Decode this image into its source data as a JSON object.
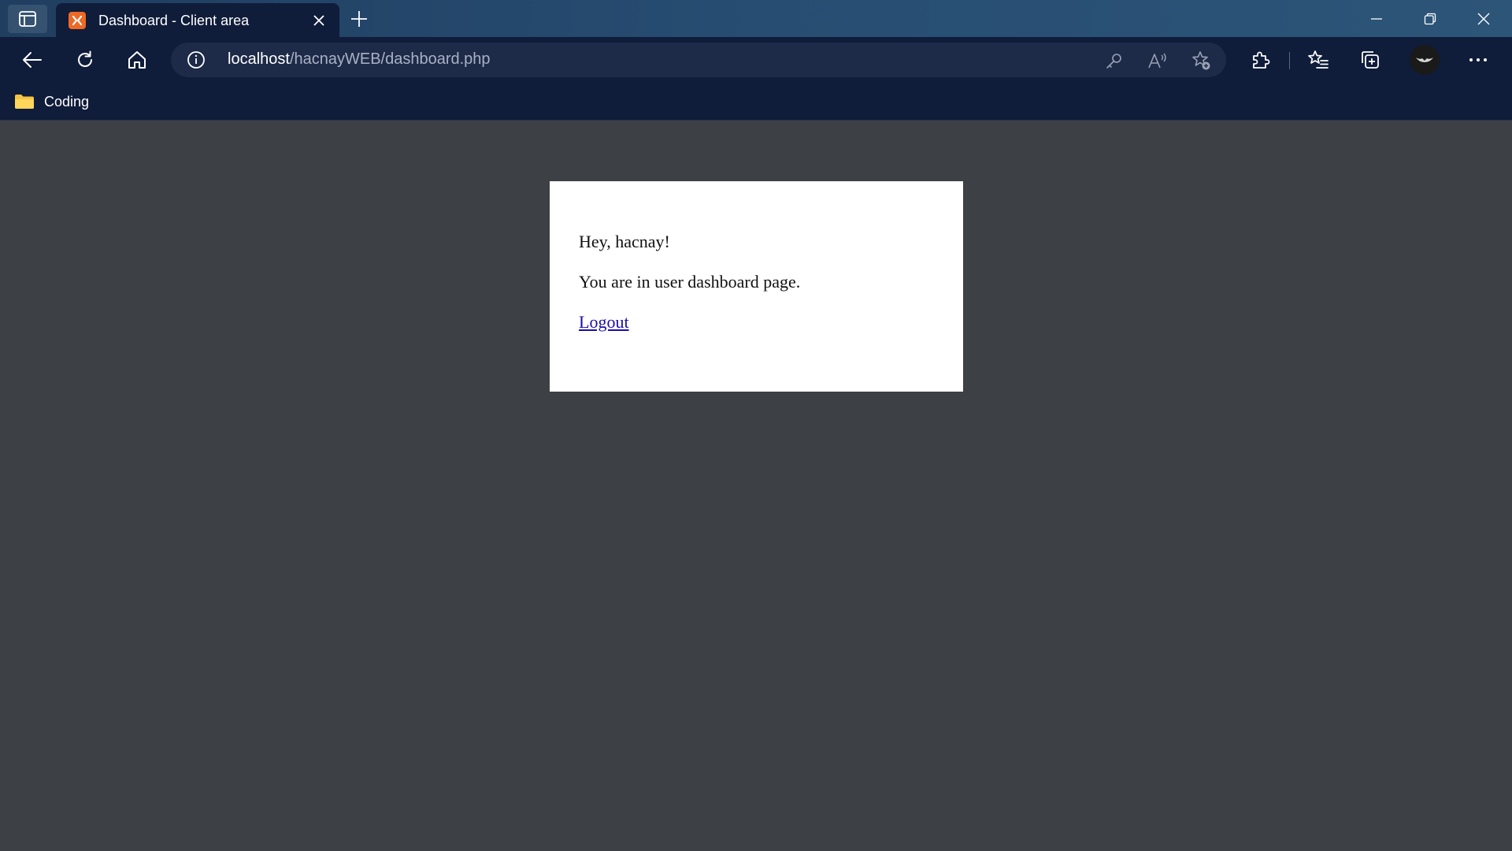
{
  "browser": {
    "tab": {
      "title": "Dashboard - Client area",
      "favicon": "xampp-icon"
    },
    "address": {
      "host": "localhost",
      "path": "/hacnayWEB/dashboard.php"
    },
    "bookmarks": [
      {
        "label": "Coding",
        "icon": "folder-icon"
      }
    ],
    "colors": {
      "titlebar": "#274d72",
      "toolbar": "#0f1c3a",
      "page_bg": "#3d4145"
    }
  },
  "page": {
    "greeting": "Hey, hacnay!",
    "message": "You are in user dashboard page.",
    "logout_label": "Logout"
  }
}
